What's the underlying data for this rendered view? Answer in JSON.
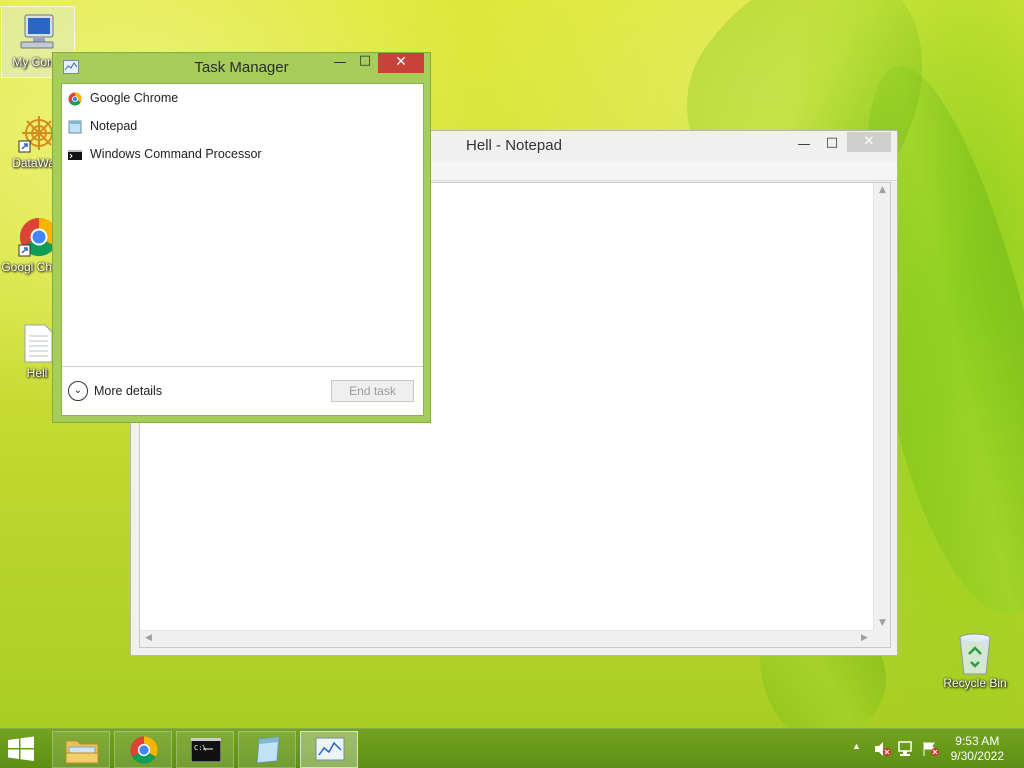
{
  "desktop": {
    "icons": [
      {
        "label": "My Comp"
      },
      {
        "label": "DataWag"
      },
      {
        "label": "Googl Chrom"
      },
      {
        "label": "Hell"
      },
      {
        "label": "Recycle Bin"
      }
    ]
  },
  "notepad": {
    "title": "Hell - Notepad",
    "content": ""
  },
  "task_manager": {
    "title": "Task Manager",
    "processes": [
      {
        "name": "Google Chrome",
        "icon": "chrome-icon"
      },
      {
        "name": "Notepad",
        "icon": "notepad-icon"
      },
      {
        "name": "Windows Command Processor",
        "icon": "cmd-icon"
      }
    ],
    "more_details_label": "More details",
    "end_task_label": "End task"
  },
  "taskbar": {
    "items": [
      "file-explorer-icon",
      "chrome-icon",
      "cmd-icon",
      "notepad-icon",
      "task-manager-icon"
    ],
    "time": "9:53 AM",
    "date": "9/30/2022"
  },
  "colors": {
    "taskmgr_frame": "#a6cc5a",
    "close_button": "#c7423a",
    "taskbar": "#6ea01e"
  }
}
